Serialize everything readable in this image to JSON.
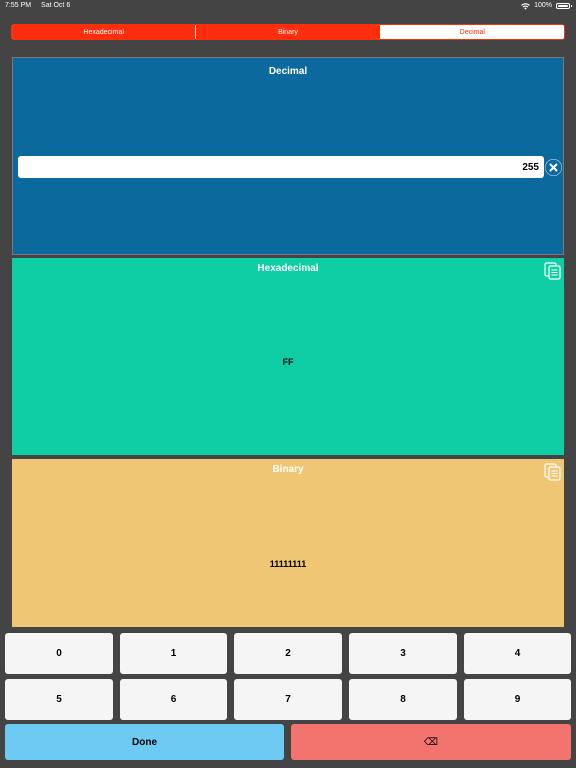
{
  "status_bar": {
    "time": "7:55 PM",
    "date": "Sat Oct 6",
    "battery": "100%"
  },
  "tabs": [
    {
      "label": "Hexadecimal",
      "active": false
    },
    {
      "label": "Binary",
      "active": false
    },
    {
      "label": "Decimal",
      "active": true
    }
  ],
  "decimal": {
    "title": "Decimal",
    "value": "255"
  },
  "hex": {
    "title": "Hexadecimal",
    "value": "FF"
  },
  "binary": {
    "title": "Binary",
    "value": "11111111"
  },
  "keypad": {
    "row1": [
      "0",
      "1",
      "2",
      "3",
      "4"
    ],
    "row2": [
      "5",
      "6",
      "7",
      "8",
      "9"
    ],
    "done": "Done",
    "backspace": "⌫"
  },
  "colors": {
    "accent": "#ff2e0d",
    "decimal_bg": "#0c699e",
    "hex_bg": "#0fcea5",
    "binary_bg": "#efc774",
    "done_bg": "#6dcaf2",
    "backspace_bg": "#f3736f"
  },
  "icons": {
    "copy": "copy-icon",
    "clear": "clear-icon",
    "wifi": "wifi-icon",
    "battery": "battery-icon"
  }
}
